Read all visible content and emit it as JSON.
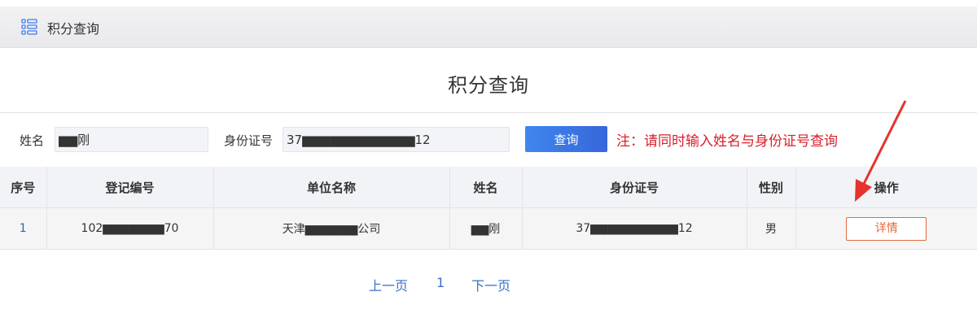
{
  "header": {
    "menu_icon": "list-menu-icon",
    "breadcrumb": "积分查询"
  },
  "page": {
    "title": "积分查询"
  },
  "search": {
    "name_label": "姓名",
    "name_value": "▆▆刚",
    "id_label": "身份证号",
    "id_value": "37▆▆▆▆▆▆▆▆▆▆▆▆12",
    "query_button": "查询",
    "note": "注：请同时输入姓名与身份证号查询"
  },
  "table": {
    "columns": [
      "序号",
      "登记编号",
      "单位名称",
      "姓名",
      "身份证号",
      "性别",
      "操作"
    ],
    "rows": [
      {
        "index": "1",
        "reg_no": "102▆▆▆▆▆▆▆70",
        "unit": "天津▆▆▆▆▆▆公司",
        "name": "▆▆刚",
        "id_no": "37▆▆▆▆▆▆▆▆▆▆12",
        "gender": "男",
        "action": "详情"
      }
    ]
  },
  "pager": {
    "prev": "上一页",
    "page": "1",
    "next": "下一页"
  },
  "colors": {
    "accent": "#3f86ee",
    "note": "#d8202c",
    "detail": "#e26a3c",
    "arrow": "#e5322e"
  }
}
